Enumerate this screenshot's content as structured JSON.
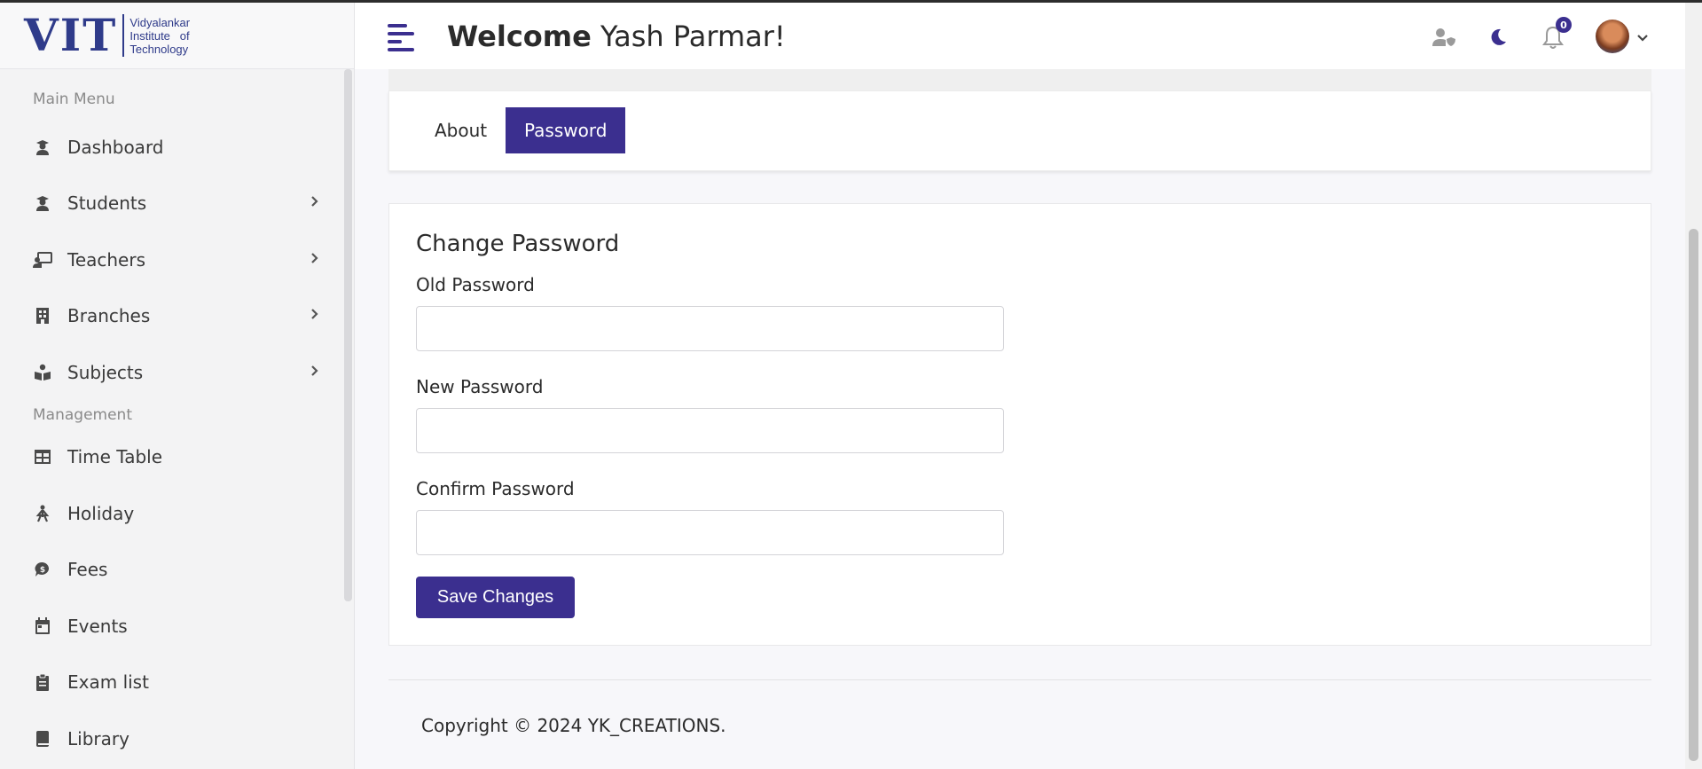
{
  "logo": {
    "mark": "VIT",
    "line1": "Vidyalankar",
    "line2": "Institute   of",
    "line3": "Technology"
  },
  "sidebar": {
    "section_main": "Main Menu",
    "section_management": "Management",
    "main_items": [
      {
        "label": "Dashboard",
        "icon": "user-graduate-icon",
        "has_children": false
      },
      {
        "label": "Students",
        "icon": "user-graduate-icon",
        "has_children": true
      },
      {
        "label": "Teachers",
        "icon": "chalkboard-teacher-icon",
        "has_children": true
      },
      {
        "label": "Branches",
        "icon": "building-icon",
        "has_children": true
      },
      {
        "label": "Subjects",
        "icon": "book-reader-icon",
        "has_children": true
      }
    ],
    "management_items": [
      {
        "label": "Time Table",
        "icon": "table-icon"
      },
      {
        "label": "Holiday",
        "icon": "holiday-icon"
      },
      {
        "label": "Fees",
        "icon": "comment-dollar-icon"
      },
      {
        "label": "Events",
        "icon": "calendar-icon"
      },
      {
        "label": "Exam list",
        "icon": "clipboard-list-icon"
      },
      {
        "label": "Library",
        "icon": "book-icon"
      }
    ]
  },
  "header": {
    "welcome_bold": "Welcome",
    "welcome_name": "Yash Parmar!",
    "notification_count": "0"
  },
  "tabs": {
    "about": "About",
    "password": "Password",
    "active": "Password"
  },
  "form": {
    "title": "Change Password",
    "old_label": "Old Password",
    "new_label": "New Password",
    "confirm_label": "Confirm Password",
    "old_value": "",
    "new_value": "",
    "confirm_value": "",
    "save_label": "Save Changes"
  },
  "footer": {
    "text": "Copyright © 2024 YK_CREATIONS."
  },
  "colors": {
    "accent": "#3b2f8f",
    "sidebar_bg": "#f3f3f4"
  }
}
